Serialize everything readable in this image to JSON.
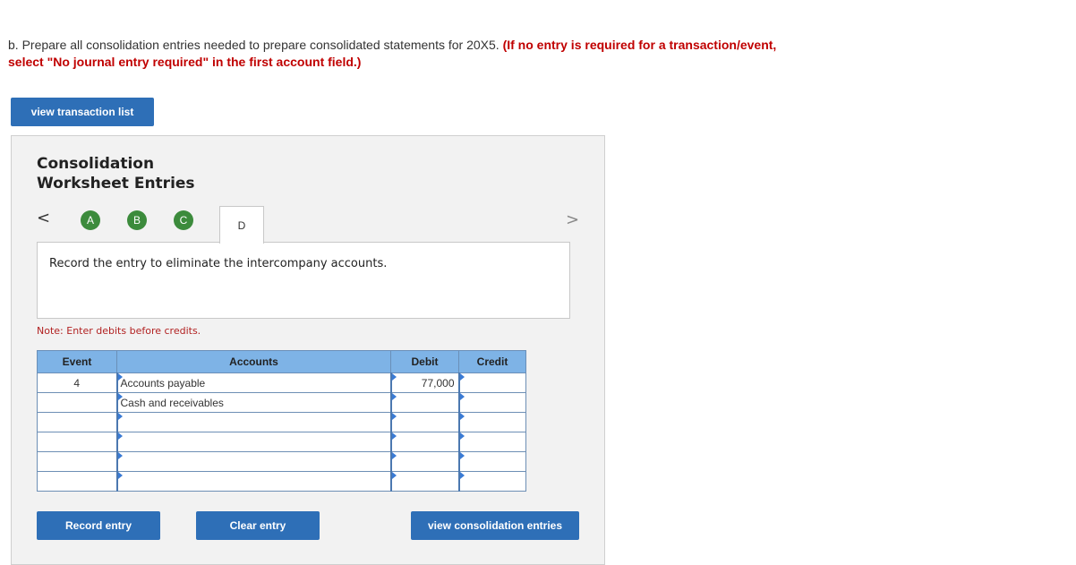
{
  "instructions": {
    "text": "b. Prepare all consolidation entries needed to prepare consolidated statements for 20X5.",
    "highlight": "(If no entry is required for a transaction/event, select \"No journal entry required\" in the first account field.)"
  },
  "buttons": {
    "view_transaction_list": "view transaction list",
    "record_entry": "Record entry",
    "clear_entry": "Clear entry",
    "view_consolidation_entries": "view consolidation entries"
  },
  "panel": {
    "title_line1": "Consolidation",
    "title_line2": "Worksheet Entries",
    "nav": {
      "prev": "<",
      "next": ">"
    },
    "tabs": [
      "A",
      "B",
      "C",
      "D"
    ],
    "active_tab": "D",
    "description": "Record the entry to eliminate the intercompany accounts.",
    "note": "Note: Enter debits before credits."
  },
  "table": {
    "headers": {
      "event": "Event",
      "accounts": "Accounts",
      "debit": "Debit",
      "credit": "Credit"
    },
    "rows": [
      {
        "event": "4",
        "account": "Accounts payable",
        "debit": "77,000",
        "credit": ""
      },
      {
        "event": "",
        "account": "Cash and receivables",
        "debit": "",
        "credit": ""
      },
      {
        "event": "",
        "account": "",
        "debit": "",
        "credit": ""
      },
      {
        "event": "",
        "account": "",
        "debit": "",
        "credit": ""
      },
      {
        "event": "",
        "account": "",
        "debit": "",
        "credit": ""
      },
      {
        "event": "",
        "account": "",
        "debit": "",
        "credit": ""
      }
    ]
  },
  "colors": {
    "button_blue": "#2e6fb7",
    "header_blue": "#7eb3e6",
    "tab_green": "#3c8b3c",
    "alert_red": "#c00000"
  }
}
